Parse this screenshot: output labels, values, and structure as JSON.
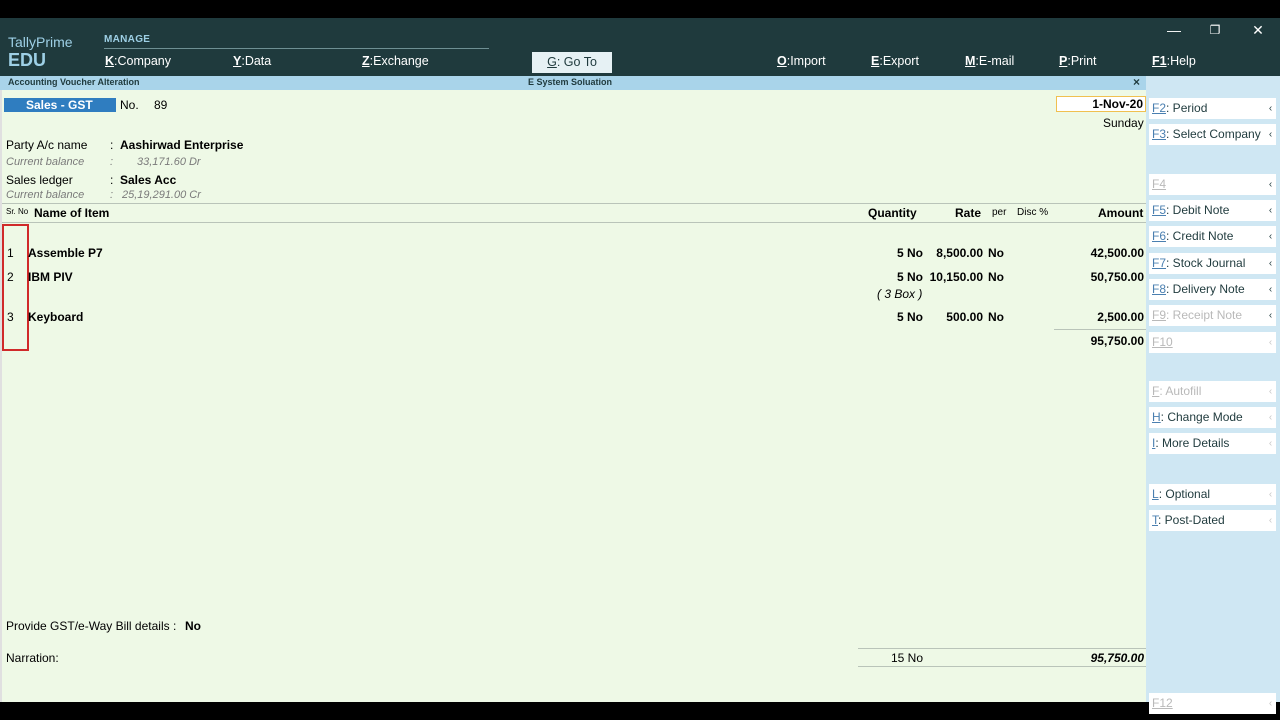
{
  "header": {
    "brand_line1": "TallyPrime",
    "brand_line2": "EDU",
    "manage_label": "MANAGE",
    "menu": [
      {
        "key": "K",
        "label": ":Company"
      },
      {
        "key": "Y",
        "label": ":Data"
      },
      {
        "key": "Z",
        "label": ":Exchange"
      },
      {
        "key": "O",
        "label": ":Import"
      },
      {
        "key": "E",
        "label": ":Export"
      },
      {
        "key": "M",
        "label": ":E-mail"
      },
      {
        "key": "P",
        "label": ":Print"
      },
      {
        "key": "F1",
        "label": ":Help"
      }
    ],
    "goto": {
      "key": "G",
      "label": ": Go To"
    },
    "window_controls": {
      "minimize": "—",
      "restore": "❐",
      "close": "✕"
    }
  },
  "titlebar": {
    "screen": "Accounting Voucher Alteration",
    "company": "E System Soluation",
    "close": "×"
  },
  "voucher": {
    "type": "Sales - GST",
    "no_label": "No.",
    "no": "89",
    "date": "1-Nov-20",
    "day": "Sunday",
    "party_label": "Party A/c name",
    "party_colon": ":",
    "party": "Aashirwad Enterprise",
    "party_balance_label": "Current balance",
    "party_balance_colon": ":",
    "party_balance": "33,171.60 Dr",
    "ledger_label": "Sales ledger",
    "ledger_colon": ":",
    "ledger": "Sales Acc",
    "ledger_balance_label": "Current balance",
    "ledger_balance_colon": ":",
    "ledger_balance": "25,19,291.00 Cr"
  },
  "table": {
    "headers": {
      "sr": "Sr. No",
      "item": "Name of Item",
      "qty": "Quantity",
      "rate": "Rate",
      "per": "per",
      "disc": "Disc %",
      "amount": "Amount"
    },
    "rows": [
      {
        "sr": "1",
        "item": "Assemble P7",
        "qty": "5 No",
        "rate": "8,500.00",
        "per": "No",
        "amount": "42,500.00",
        "note": ""
      },
      {
        "sr": "2",
        "item": "IBM PIV",
        "qty": "5 No",
        "rate": "10,150.00",
        "per": "No",
        "amount": "50,750.00",
        "note": "( 3 Box )"
      },
      {
        "sr": "3",
        "item": "Keyboard",
        "qty": "5 No",
        "rate": "500.00",
        "per": "No",
        "amount": "2,500.00",
        "note": ""
      }
    ],
    "subtotal": "95,750.00"
  },
  "footer": {
    "gst_label": "Provide GST/e-Way Bill details :",
    "gst_value": "No",
    "narration_label": "Narration:",
    "total_qty": "15 No",
    "total_amount": "95,750.00"
  },
  "panel": [
    {
      "key": "F2",
      "label": ": Period",
      "enabled": true
    },
    {
      "key": "F3",
      "label": ": Select Company",
      "enabled": true
    },
    {
      "key": "F4",
      "label": "",
      "enabled": true
    },
    {
      "key": "F5",
      "label": ": Debit Note",
      "enabled": true
    },
    {
      "key": "F6",
      "label": ": Credit Note",
      "enabled": true
    },
    {
      "key": "F7",
      "label": ": Stock Journal",
      "enabled": true
    },
    {
      "key": "F8",
      "label": ": Delivery Note",
      "enabled": true
    },
    {
      "key": "F9",
      "label": ": Receipt Note",
      "enabled": false
    },
    {
      "key": "F10",
      "label": "",
      "enabled": false
    },
    {
      "key": "F",
      "label": ": Autofill",
      "enabled": false
    },
    {
      "key": "H",
      "label": ": Change Mode",
      "enabled": true
    },
    {
      "key": "I",
      "label": ": More Details",
      "enabled": true
    },
    {
      "key": "L",
      "label": ": Optional",
      "enabled": true
    },
    {
      "key": "T",
      "label": ": Post-Dated",
      "enabled": true
    },
    {
      "key": "F12",
      "label": "",
      "enabled": false
    }
  ],
  "panel_arrow": "‹"
}
